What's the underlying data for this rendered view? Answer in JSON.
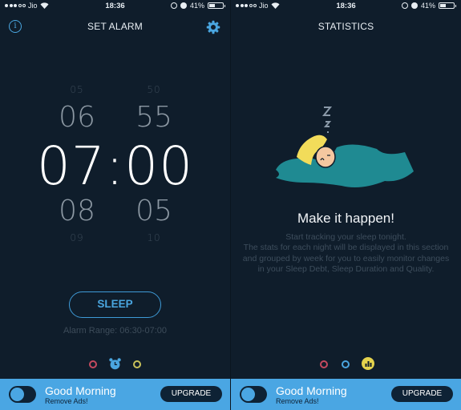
{
  "status_bar": {
    "carrier": "Jio",
    "signal_bars_filled": 3,
    "signal_bars_total": 5,
    "time": "18:36",
    "battery_percent_label": "41%",
    "battery_level": 0.41
  },
  "alarm_screen": {
    "title": "SET ALARM",
    "info_icon": "info-icon",
    "settings_icon": "gear-icon",
    "picker": {
      "hours": [
        "05",
        "06",
        "07",
        "08",
        "09"
      ],
      "minutes": [
        "50",
        "55",
        "00",
        "05",
        "10"
      ],
      "selected_time": "07:00"
    },
    "sleep_button": "SLEEP",
    "alarm_range": "Alarm Range: 06:30-07:00",
    "page_indicator": {
      "active_index": 1,
      "items": [
        "journal",
        "alarm-clock-icon",
        "statistics"
      ]
    }
  },
  "stats_screen": {
    "title": "STATISTICS",
    "heading": "Make it happen!",
    "body": "Start tracking your sleep tonight.\nThe stats for each night will be displayed in this section and grouped by week for you to easily monitor changes in your Sleep Debt, Sleep Duration and Quality.",
    "page_indicator": {
      "active_index": 2,
      "items": [
        "journal",
        "alarm",
        "bar-chart-icon"
      ]
    }
  },
  "ad_banner": {
    "title": "Good Morning",
    "subtitle": "Remove Ads!",
    "upgrade_button": "UPGRADE"
  },
  "colors": {
    "background": "#0f1d2b",
    "accent_blue": "#4aa6e0",
    "ad_bar": "#4aa6e3",
    "dark_navy": "#0e2235",
    "indicator_red": "#c44a5f",
    "indicator_yellow": "#e4d34d",
    "blanket_teal": "#1f8a92",
    "hair_yellow": "#f2dc5a"
  }
}
